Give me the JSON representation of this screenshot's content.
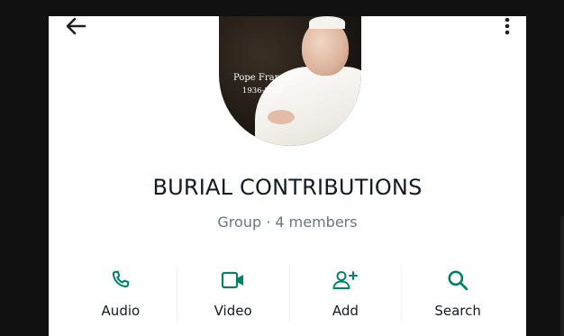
{
  "header": {
    "back_icon": "arrow-left-icon",
    "more_icon": "more-vertical-icon"
  },
  "avatar": {
    "caption_name": "Pope Francis",
    "caption_years": "1936-2025"
  },
  "group": {
    "name": "BURIAL CONTRIBUTIONS",
    "meta": "Group · 4 members"
  },
  "actions": [
    {
      "label": "Audio",
      "icon": "phone-icon"
    },
    {
      "label": "Video",
      "icon": "video-camera-icon"
    },
    {
      "label": "Add",
      "icon": "add-person-icon"
    },
    {
      "label": "Search",
      "icon": "search-icon"
    }
  ],
  "colors": {
    "accent": "#008069",
    "text_primary": "#111b21",
    "text_secondary": "#667781"
  }
}
